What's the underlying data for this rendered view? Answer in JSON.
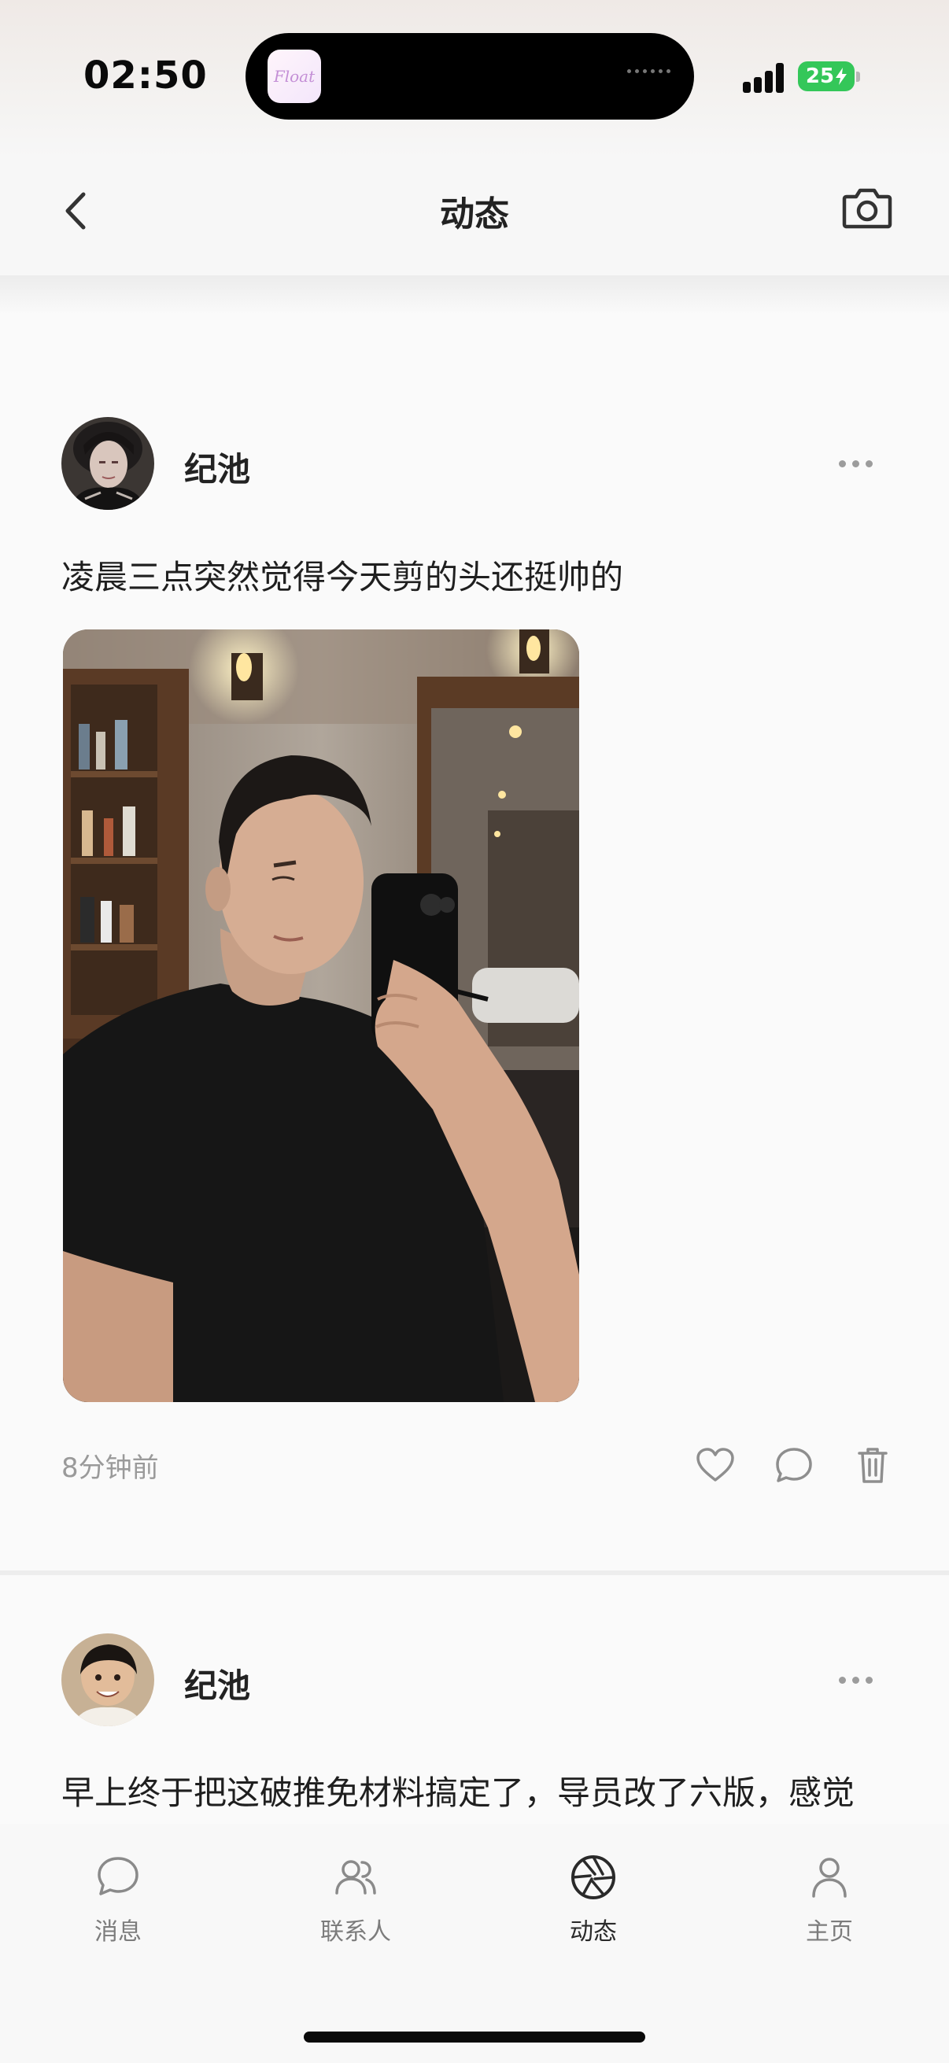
{
  "status_bar": {
    "time": "02:50",
    "island_app": "Float",
    "battery_level": "25",
    "battery_color": "#34c759"
  },
  "nav": {
    "title": "动态",
    "back_icon": "chevron-left-icon",
    "camera_icon": "camera-icon"
  },
  "posts": [
    {
      "author": "纪池",
      "text": "凌晨三点突然觉得今天剪的头还挺帅的",
      "time": "8分钟前",
      "actions": [
        "heart-icon",
        "comment-icon",
        "trash-icon"
      ]
    },
    {
      "author": "纪池",
      "text": "早上终于把这破推免材料搞定了，导员改了六版，感觉"
    }
  ],
  "tabbar": {
    "items": [
      {
        "label": "消息",
        "icon": "chat-bubble-icon",
        "active": false
      },
      {
        "label": "联系人",
        "icon": "contacts-icon",
        "active": false
      },
      {
        "label": "动态",
        "icon": "aperture-icon",
        "active": true
      },
      {
        "label": "主页",
        "icon": "person-icon",
        "active": false
      }
    ]
  }
}
